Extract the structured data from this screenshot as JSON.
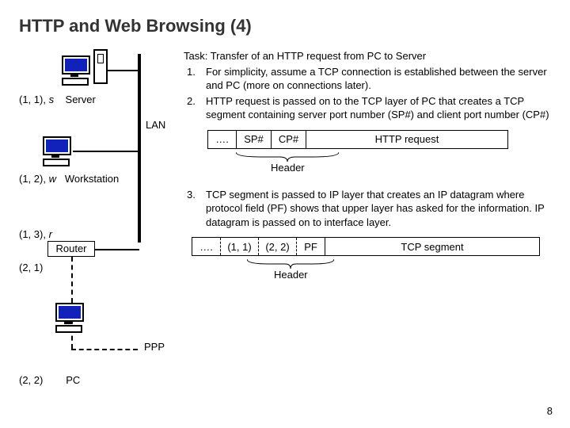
{
  "title": "HTTP and Web Browsing (4)",
  "nodes": {
    "server": {
      "addr": "(1, 1), ",
      "var": "s",
      "label": "Server"
    },
    "workstation": {
      "addr": "(1, 2), ",
      "var": "w",
      "label": "Workstation"
    },
    "router_addr1": "(1, 3), ",
    "router_var": "r",
    "router_label": "Router",
    "router_addr2": "(2, 1)",
    "pc": {
      "addr": "(2, 2)",
      "label": "PC"
    }
  },
  "lan_label": "LAN",
  "ppp_label": "PPP",
  "task": {
    "heading": "Task: Transfer of an HTTP request from PC to Server",
    "steps": [
      {
        "n": "1.",
        "text": "For simplicity, assume a TCP connection is established between the server and PC (more on connections later)."
      },
      {
        "n": "2.",
        "text": "HTTP request is passed on to the TCP layer of PC that creates a TCP segment containing server port number (SP#) and client port number (CP#)"
      },
      {
        "n": "3.",
        "text": "TCP segment is passed to IP layer that creates an IP datagram where protocol field (PF) shows that upper layer has asked for the information. IP datagram is passed on to interface layer."
      }
    ]
  },
  "packet_tcp": {
    "dots": "….",
    "sp": "SP#",
    "cp": "CP#",
    "payload": "HTTP request",
    "header_label": "Header"
  },
  "packet_ip": {
    "dots": "….",
    "src": "(1, 1)",
    "dst": "(2, 2)",
    "pf": "PF",
    "payload": "TCP segment",
    "header_label": "Header"
  },
  "page_number": "8"
}
